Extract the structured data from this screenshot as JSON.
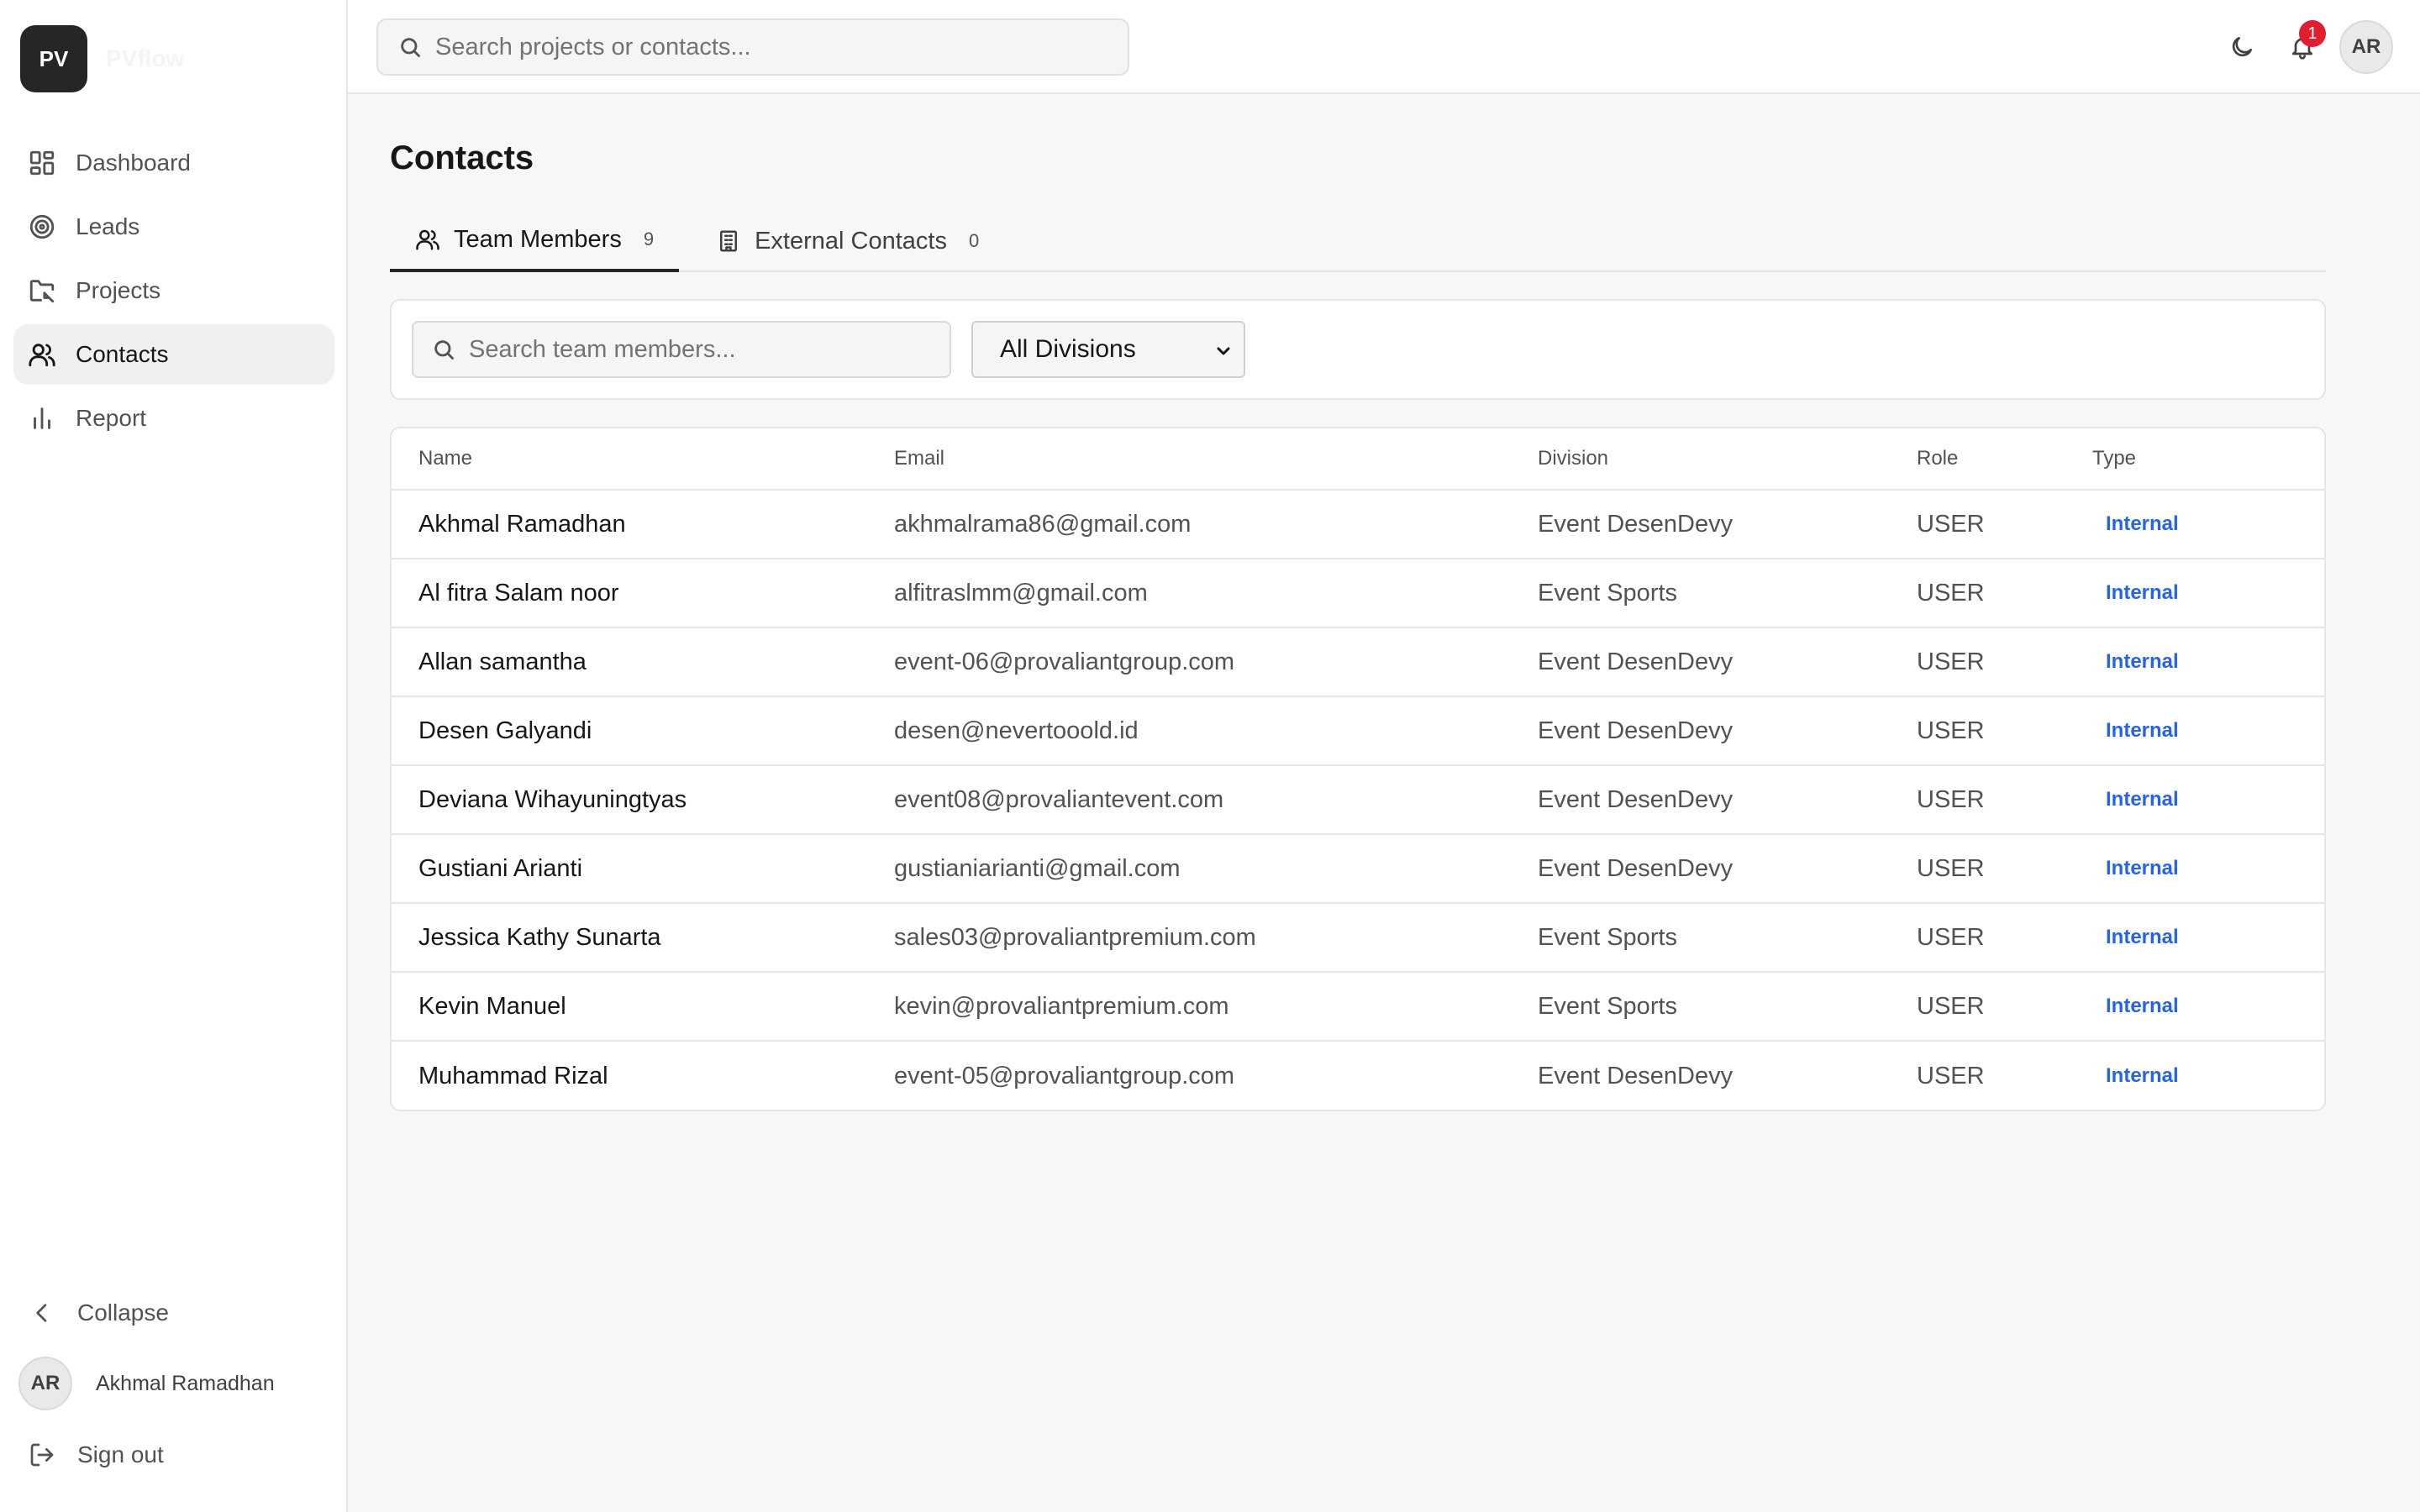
{
  "brand": {
    "logo": "PV",
    "name": "PVflow"
  },
  "sidebar": {
    "items": [
      {
        "label": "Dashboard",
        "icon": "dashboard-icon"
      },
      {
        "label": "Leads",
        "icon": "target-icon"
      },
      {
        "label": "Projects",
        "icon": "folder-icon"
      },
      {
        "label": "Contacts",
        "icon": "users-icon",
        "active": true
      },
      {
        "label": "Report",
        "icon": "bar-chart-icon"
      }
    ],
    "collapse_label": "Collapse",
    "user": {
      "initials": "AR",
      "name": "Akhmal Ramadhan"
    },
    "signout_label": "Sign out"
  },
  "header": {
    "search_placeholder": "Search projects or contacts...",
    "notification_count": "1",
    "avatar_initials": "AR"
  },
  "main": {
    "title": "Contacts",
    "tabs": [
      {
        "label": "Team Members",
        "count": "9",
        "active": true
      },
      {
        "label": "External Contacts",
        "count": "0"
      }
    ],
    "filter": {
      "search_placeholder": "Search team members...",
      "division_selected": "All Divisions"
    },
    "table": {
      "columns": [
        "Name",
        "Email",
        "Division",
        "Role",
        "Type"
      ],
      "rows": [
        {
          "name": "Akhmal Ramadhan",
          "email": "akhmalrama86@gmail.com",
          "division": "Event DesenDevy",
          "role": "USER",
          "type": "Internal"
        },
        {
          "name": "Al fitra Salam noor",
          "email": "alfitraslmm@gmail.com",
          "division": "Event Sports",
          "role": "USER",
          "type": "Internal"
        },
        {
          "name": "Allan samantha",
          "email": "event-06@provaliantgroup.com",
          "division": "Event DesenDevy",
          "role": "USER",
          "type": "Internal"
        },
        {
          "name": "Desen Galyandi",
          "email": "desen@nevertooold.id",
          "division": "Event DesenDevy",
          "role": "USER",
          "type": "Internal"
        },
        {
          "name": "Deviana Wihayuningtyas",
          "email": "event08@provaliantevent.com",
          "division": "Event DesenDevy",
          "role": "USER",
          "type": "Internal"
        },
        {
          "name": "Gustiani Arianti",
          "email": "gustianiarianti@gmail.com",
          "division": "Event DesenDevy",
          "role": "USER",
          "type": "Internal"
        },
        {
          "name": "Jessica Kathy Sunarta",
          "email": "sales03@provaliantpremium.com",
          "division": "Event Sports",
          "role": "USER",
          "type": "Internal"
        },
        {
          "name": "Kevin Manuel",
          "email": "kevin@provaliantpremium.com",
          "division": "Event Sports",
          "role": "USER",
          "type": "Internal"
        },
        {
          "name": "Muhammad Rizal",
          "email": "event-05@provaliantgroup.com",
          "division": "Event DesenDevy",
          "role": "USER",
          "type": "Internal"
        }
      ]
    }
  },
  "colors": {
    "accent": "#2563eb",
    "badge": "#e11d2e",
    "logo_bg": "#262626"
  }
}
